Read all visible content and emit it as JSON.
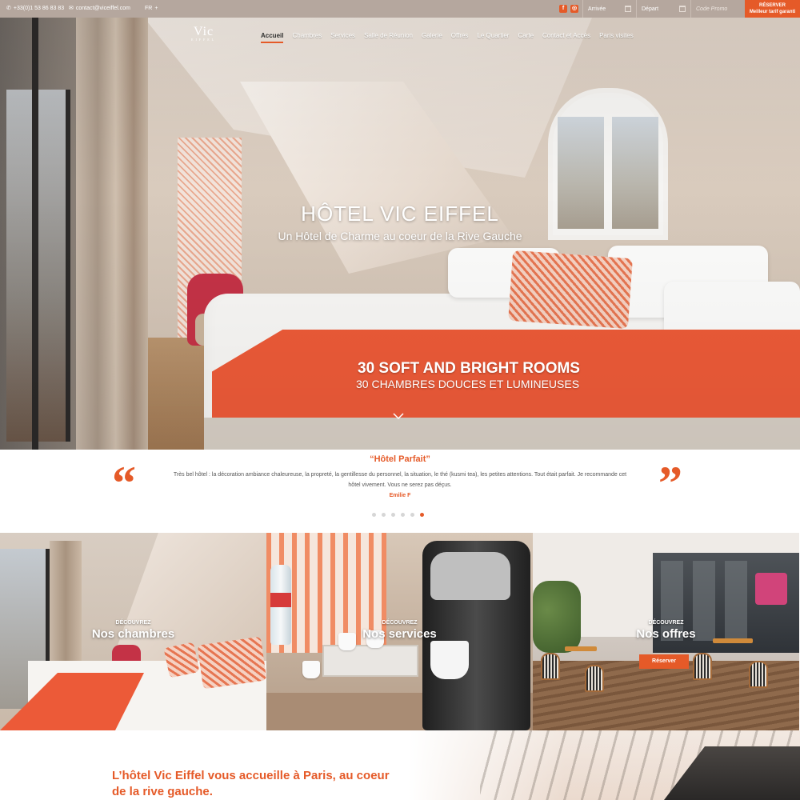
{
  "topbar": {
    "phone": "+33(0)1 53 86 83 83",
    "email": "contact@viceiffel.com",
    "language": "FR",
    "language_caret": "+",
    "social": {
      "facebook": "f",
      "instagram": "◎"
    },
    "arrival_label": "Arrivée",
    "departure_label": "Départ",
    "promo_placeholder": "Code Promo",
    "reserve_label": "RÉSERVER",
    "reserve_sub": "Meilleur tarif garanti"
  },
  "brand": {
    "logo_text": "Vic",
    "logo_sub": "EIFFEL"
  },
  "nav": {
    "items": [
      "Accueil",
      "Chambres",
      "Services",
      "Salle de Réunion",
      "Galerie",
      "Offres",
      "Le Quartier",
      "Carte",
      "Contact et Accès",
      "Paris visites"
    ],
    "active": "Accueil"
  },
  "hero": {
    "title": "HÔTEL VIC EIFFEL",
    "subtitle": "Un Hôtel de Charme au coeur de la Rive Gauche",
    "tagline_en": "30 SOFT AND BRIGHT ROOMS",
    "tagline_fr": "30 CHAMBRES DOUCES ET LUMINEUSES"
  },
  "testimonial": {
    "title": "“Hôtel Parfait”",
    "text": "Très bel hôtel : la décoration ambiance chaleureuse, la propreté, la gentillesse du personnel, la situation, le thé (kusmi tea), les petites attentions. Tout était parfait. Je recommande cet hôtel vivement. Vous ne serez pas déçus.",
    "author": "Emilie F",
    "open_quote": "“",
    "close_quote": "”",
    "dots_total": 6,
    "dots_active": 6
  },
  "tiles": [
    {
      "small": "DÉCOUVREZ",
      "big": "Nos chambres"
    },
    {
      "small": "DÉCOUVREZ",
      "big": "Nos services"
    },
    {
      "small": "DÉCOUVREZ",
      "big": "Nos offres",
      "button": "Réserver"
    }
  ],
  "intro": {
    "title": "L’hôtel Vic Eiffel vous accueille à Paris, au coeur de la rive gauche."
  },
  "colors": {
    "accent": "#e55a28",
    "topbar": "#b5a79e"
  }
}
